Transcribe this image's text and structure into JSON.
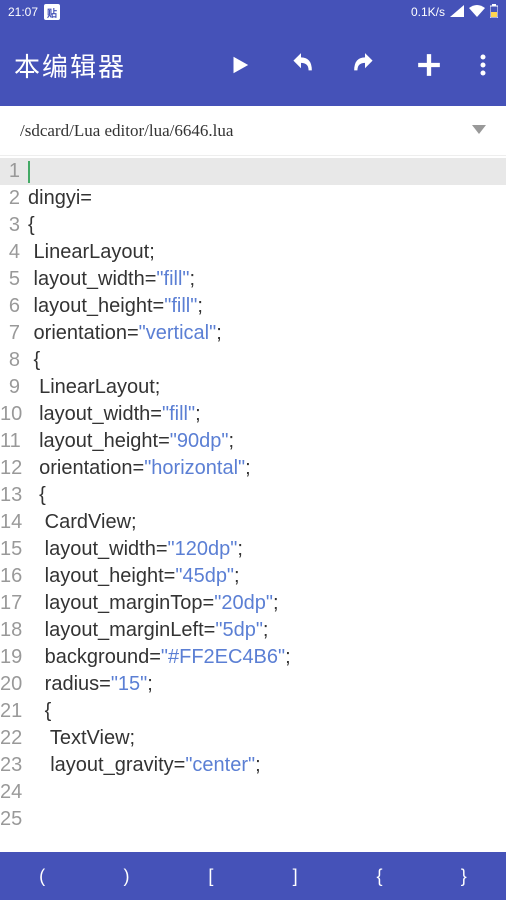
{
  "status": {
    "time": "21:07",
    "app_badge": "贴",
    "net_speed": "0.1K/s"
  },
  "toolbar": {
    "title": "本编辑器"
  },
  "path": "/sdcard/Lua editor/lua/6646.lua",
  "code": {
    "lines": [
      {
        "n": 1,
        "segs": []
      },
      {
        "n": 2,
        "segs": []
      },
      {
        "n": 3,
        "segs": []
      },
      {
        "n": 4,
        "segs": [
          {
            "t": "dingyi="
          }
        ]
      },
      {
        "n": 5,
        "segs": [
          {
            "t": "{"
          }
        ]
      },
      {
        "n": 6,
        "segs": [
          {
            "t": " LinearLayout;"
          }
        ]
      },
      {
        "n": 7,
        "segs": [
          {
            "t": " layout_width="
          },
          {
            "t": "\"fill\"",
            "c": "kw-str"
          },
          {
            "t": ";"
          }
        ]
      },
      {
        "n": 8,
        "segs": [
          {
            "t": " layout_height="
          },
          {
            "t": "\"fill\"",
            "c": "kw-str"
          },
          {
            "t": ";"
          }
        ]
      },
      {
        "n": 9,
        "segs": [
          {
            "t": " orientation="
          },
          {
            "t": "\"vertical\"",
            "c": "kw-str"
          },
          {
            "t": ";"
          }
        ]
      },
      {
        "n": 10,
        "segs": [
          {
            "t": " {"
          }
        ]
      },
      {
        "n": 11,
        "segs": [
          {
            "t": "  LinearLayout;"
          }
        ]
      },
      {
        "n": 12,
        "segs": [
          {
            "t": "  layout_width="
          },
          {
            "t": "\"fill\"",
            "c": "kw-str"
          },
          {
            "t": ";"
          }
        ]
      },
      {
        "n": 13,
        "segs": [
          {
            "t": "  layout_height="
          },
          {
            "t": "\"90dp\"",
            "c": "kw-str"
          },
          {
            "t": ";"
          }
        ]
      },
      {
        "n": 14,
        "segs": [
          {
            "t": "  orientation="
          },
          {
            "t": "\"horizontal\"",
            "c": "kw-str"
          },
          {
            "t": ";"
          }
        ]
      },
      {
        "n": 15,
        "segs": [
          {
            "t": "  {"
          }
        ]
      },
      {
        "n": 16,
        "segs": [
          {
            "t": "   CardView;"
          }
        ]
      },
      {
        "n": 17,
        "segs": [
          {
            "t": "   layout_width="
          },
          {
            "t": "\"120dp\"",
            "c": "kw-str"
          },
          {
            "t": ";"
          }
        ]
      },
      {
        "n": 18,
        "segs": [
          {
            "t": "   layout_height="
          },
          {
            "t": "\"45dp\"",
            "c": "kw-str"
          },
          {
            "t": ";"
          }
        ]
      },
      {
        "n": 19,
        "segs": [
          {
            "t": "   layout_marginTop="
          },
          {
            "t": "\"20dp\"",
            "c": "kw-str"
          },
          {
            "t": ";"
          }
        ]
      },
      {
        "n": 20,
        "segs": [
          {
            "t": "   layout_marginLeft="
          },
          {
            "t": "\"5dp\"",
            "c": "kw-str"
          },
          {
            "t": ";"
          }
        ]
      },
      {
        "n": 21,
        "segs": [
          {
            "t": "   background="
          },
          {
            "t": "\"#FF2EC4B6\"",
            "c": "kw-str"
          },
          {
            "t": ";"
          }
        ]
      },
      {
        "n": 22,
        "segs": [
          {
            "t": "   radius="
          },
          {
            "t": "\"15\"",
            "c": "kw-str"
          },
          {
            "t": ";"
          }
        ]
      },
      {
        "n": 23,
        "segs": [
          {
            "t": "   {"
          }
        ]
      },
      {
        "n": 24,
        "segs": [
          {
            "t": "    TextView;"
          }
        ]
      },
      {
        "n": 25,
        "segs": [
          {
            "t": "    layout_gravity="
          },
          {
            "t": "\"center\"",
            "c": "kw-str"
          },
          {
            "t": ";"
          }
        ]
      }
    ]
  },
  "bottom_keys": [
    "(",
    ")",
    "[",
    "]",
    "{",
    "}"
  ]
}
